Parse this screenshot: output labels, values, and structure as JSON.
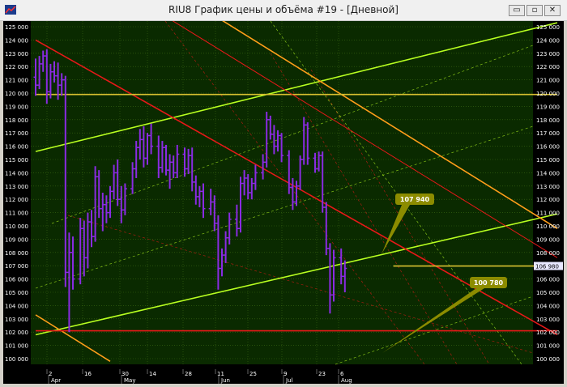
{
  "window": {
    "title": "RIU8 График цены и объёма #19 - [Дневной]",
    "buttons": {
      "minimize": "▭",
      "maximize": "▫",
      "close": "✕"
    }
  },
  "colors": {
    "chart_bg": "#0a2a00",
    "grid": "#3d6a12",
    "bars": "#8a2be2",
    "green_channel": "#b8ff20",
    "orange_lines": "#ff9e1a",
    "red_lines": "#e81818",
    "yellow_hline": "#d8c030",
    "callout": "#8c8c00",
    "price_label_bg": "#e8e8ff"
  },
  "price_axis": {
    "labels": [
      "125 000",
      "124 000",
      "123 000",
      "122 000",
      "121 000",
      "120 000",
      "119 000",
      "118 000",
      "117 000",
      "116 000",
      "115 000",
      "114 000",
      "113 000",
      "112 000",
      "111 000",
      "110 000",
      "109 000",
      "108 000",
      "107 000",
      "106 000",
      "105 000",
      "104 000",
      "103 000",
      "102 000",
      "101 000",
      "100 000"
    ],
    "last_price_tag": "106 980"
  },
  "time_axis": {
    "day_labels": [
      "2",
      "16",
      "30",
      "14",
      "28",
      "11",
      "25",
      "9",
      "23",
      "6"
    ],
    "month_labels": [
      "Apr",
      "May",
      "Jun",
      "Jul",
      "Aug"
    ]
  },
  "callouts": [
    {
      "text": "107 940"
    },
    {
      "text": "100 780"
    }
  ],
  "chart_data": {
    "type": "bar",
    "symbol": "RIU8",
    "ylim": [
      100000,
      125000
    ],
    "x_range_days": [
      0,
      140
    ],
    "ohlc": [
      [
        0,
        121200,
        122600,
        119800,
        120600
      ],
      [
        1,
        120600,
        122800,
        120300,
        122200
      ],
      [
        2,
        122200,
        123200,
        121600,
        122800
      ],
      [
        3,
        122800,
        123300,
        119200,
        120100
      ],
      [
        4,
        120100,
        122200,
        119600,
        121600
      ],
      [
        5,
        121600,
        122400,
        120800,
        121300
      ],
      [
        6,
        121300,
        122300,
        119500,
        120600
      ],
      [
        7,
        120600,
        121500,
        119800,
        121000
      ],
      [
        8,
        121000,
        121300,
        105400,
        106500
      ],
      [
        9,
        106500,
        109500,
        102000,
        108000
      ],
      [
        10,
        108000,
        109200,
        105200,
        106000
      ],
      [
        12,
        106000,
        110600,
        105600,
        109800
      ],
      [
        13,
        109800,
        110400,
        106200,
        107600
      ],
      [
        14,
        107600,
        111000,
        106800,
        110300
      ],
      [
        15,
        110300,
        111200,
        108400,
        109200
      ],
      [
        16,
        109200,
        114500,
        108800,
        113700
      ],
      [
        17,
        113700,
        114200,
        110600,
        111300
      ],
      [
        18,
        111300,
        112500,
        109600,
        111600
      ],
      [
        19,
        111600,
        112300,
        110200,
        111000
      ],
      [
        20,
        111000,
        113000,
        110600,
        112600
      ],
      [
        21,
        112600,
        114600,
        112000,
        114000
      ],
      [
        22,
        114000,
        115000,
        111500,
        112000
      ],
      [
        23,
        112000,
        113000,
        110200,
        111200
      ],
      [
        24,
        111200,
        113200,
        110800,
        112800
      ],
      [
        26,
        112800,
        114800,
        112400,
        114300
      ],
      [
        27,
        114300,
        116400,
        113600,
        115900
      ],
      [
        28,
        115900,
        117300,
        115000,
        116500
      ],
      [
        29,
        116500,
        117500,
        114400,
        115100
      ],
      [
        30,
        115100,
        117000,
        114600,
        116800
      ],
      [
        31,
        116800,
        117700,
        115400,
        116000
      ],
      [
        33,
        116000,
        116800,
        113600,
        114400
      ],
      [
        34,
        114400,
        116400,
        114000,
        115900
      ],
      [
        35,
        115900,
        116100,
        113800,
        114200
      ],
      [
        36,
        114200,
        115400,
        112800,
        114800
      ],
      [
        37,
        114800,
        115300,
        113600,
        114000
      ],
      [
        38,
        114000,
        116100,
        113600,
        115400
      ],
      [
        40,
        115400,
        115900,
        113700,
        114300
      ],
      [
        41,
        114300,
        115800,
        113900,
        115300
      ],
      [
        42,
        115300,
        115900,
        112600,
        113300
      ],
      [
        43,
        113300,
        113800,
        111600,
        112200
      ],
      [
        44,
        112200,
        113000,
        111400,
        112600
      ],
      [
        45,
        112600,
        113200,
        110600,
        111300
      ],
      [
        47,
        111300,
        112800,
        110800,
        111800
      ],
      [
        48,
        111800,
        112300,
        109600,
        110200
      ],
      [
        49,
        110200,
        110800,
        105200,
        106800
      ],
      [
        50,
        106800,
        108300,
        106200,
        107800
      ],
      [
        51,
        107800,
        109600,
        107200,
        109100
      ],
      [
        52,
        109100,
        111000,
        108600,
        110500
      ],
      [
        54,
        110500,
        111600,
        109200,
        109800
      ],
      [
        55,
        109800,
        113700,
        109500,
        113200
      ],
      [
        56,
        113200,
        114200,
        112300,
        113600
      ],
      [
        57,
        113600,
        113900,
        112000,
        112500
      ],
      [
        58,
        112500,
        113600,
        112000,
        113200
      ],
      [
        59,
        113200,
        114600,
        112700,
        114000
      ],
      [
        61,
        114000,
        115400,
        113500,
        114800
      ],
      [
        62,
        114800,
        118600,
        114400,
        118000
      ],
      [
        63,
        118000,
        118300,
        116500,
        116900
      ],
      [
        64,
        116900,
        117600,
        115400,
        116000
      ],
      [
        65,
        116000,
        117200,
        115600,
        116800
      ],
      [
        66,
        116800,
        117000,
        114800,
        115300
      ],
      [
        68,
        115300,
        115700,
        112400,
        112900
      ],
      [
        69,
        112900,
        113600,
        111200,
        111800
      ],
      [
        70,
        111800,
        113400,
        111500,
        113000
      ],
      [
        71,
        113000,
        115300,
        112700,
        115000
      ],
      [
        72,
        115000,
        118200,
        114600,
        117600
      ],
      [
        73,
        117600,
        117800,
        114600,
        115100
      ],
      [
        75,
        115100,
        115500,
        114000,
        114300
      ],
      [
        76,
        114300,
        115600,
        114100,
        115300
      ],
      [
        77,
        115300,
        115600,
        111000,
        111400
      ],
      [
        78,
        111400,
        111800,
        107800,
        108300
      ],
      [
        79,
        108300,
        108700,
        103400,
        104800
      ],
      [
        80,
        104800,
        108200,
        104300,
        107600
      ],
      [
        82,
        107600,
        108300,
        105600,
        106200
      ],
      [
        83,
        106200,
        107400,
        105000,
        106800
      ]
    ],
    "lines": [
      {
        "name": "green channel upper",
        "color": "#b8ff20",
        "points": [
          [
            0,
            115600
          ],
          [
            140,
            125300
          ]
        ]
      },
      {
        "name": "green channel lower",
        "color": "#b8ff20",
        "points": [
          [
            0,
            101800
          ],
          [
            140,
            110900
          ]
        ]
      },
      {
        "name": "orange upper",
        "color": "#ff9e1a",
        "points": [
          [
            0,
            134200
          ],
          [
            140,
            109800
          ]
        ]
      },
      {
        "name": "orange lower",
        "color": "#ff9e1a",
        "points": [
          [
            0,
            103300
          ],
          [
            20,
            99800
          ]
        ]
      },
      {
        "name": "red diagonal",
        "color": "#e81818",
        "points": [
          [
            0,
            124000
          ],
          [
            140,
            101800
          ]
        ]
      },
      {
        "name": "red horizontal",
        "color": "#e81818",
        "points": [
          [
            0,
            102100
          ],
          [
            140,
            102100
          ]
        ]
      },
      {
        "name": "yellow 120000",
        "color": "#d8c030",
        "points": [
          [
            0,
            119900
          ],
          [
            140,
            119900
          ]
        ]
      },
      {
        "name": "yellow 107000",
        "color": "#d8c030",
        "points": [
          [
            96,
            106980
          ],
          [
            140,
            106980
          ]
        ]
      }
    ]
  }
}
